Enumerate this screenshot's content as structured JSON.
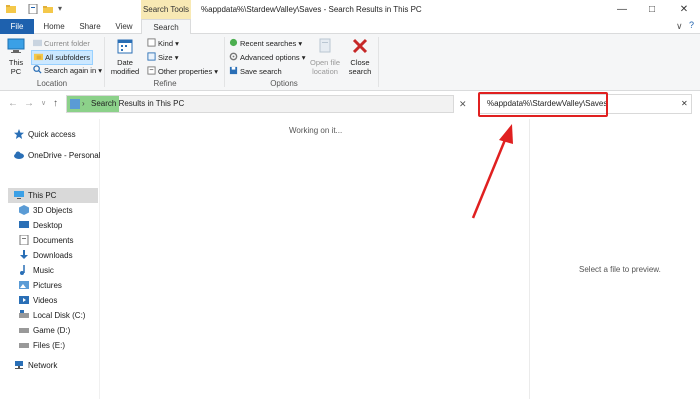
{
  "titlebar": {
    "context_tab": "Search Tools",
    "title": "%appdata%\\StardewValley\\Saves - Search Results in This PC",
    "minimize": "—",
    "maximize": "□",
    "close": "✕"
  },
  "tabs": [
    "File",
    "Home",
    "Share",
    "View",
    "Search"
  ],
  "ribbon": {
    "location": {
      "this_pc": "This PC",
      "current_folder": "Current folder",
      "all_subfolders": "All subfolders",
      "search_again_in": "Search again in",
      "label": "Location"
    },
    "refine": {
      "date_modified": "Date modified",
      "kind": "Kind",
      "size": "Size",
      "other_properties": "Other properties",
      "label": "Refine"
    },
    "options": {
      "recent_searches": "Recent searches",
      "advanced_options": "Advanced options",
      "save_search": "Save search",
      "open_file_location": "Open file location",
      "label": "Options"
    },
    "close_search": "Close search"
  },
  "address": {
    "path": "Search Results in This PC",
    "search_value": "%appdata%\\StardewValley\\Saves"
  },
  "nav": {
    "quick_access": "Quick access",
    "onedrive": "OneDrive - Personal",
    "this_pc": "This PC",
    "objects3d": "3D Objects",
    "desktop": "Desktop",
    "documents": "Documents",
    "downloads": "Downloads",
    "music": "Music",
    "pictures": "Pictures",
    "videos": "Videos",
    "local_disk": "Local Disk (C:)",
    "game": "Game (D:)",
    "files": "Files (E:)",
    "network": "Network"
  },
  "content": {
    "working": "Working on it...",
    "preview": "Select a file to preview."
  },
  "colors": {
    "file_tab": "#1e61ae",
    "context_tab": "#f8e9b4",
    "highlight": "#8cd18a",
    "annotation": "#e02020"
  }
}
